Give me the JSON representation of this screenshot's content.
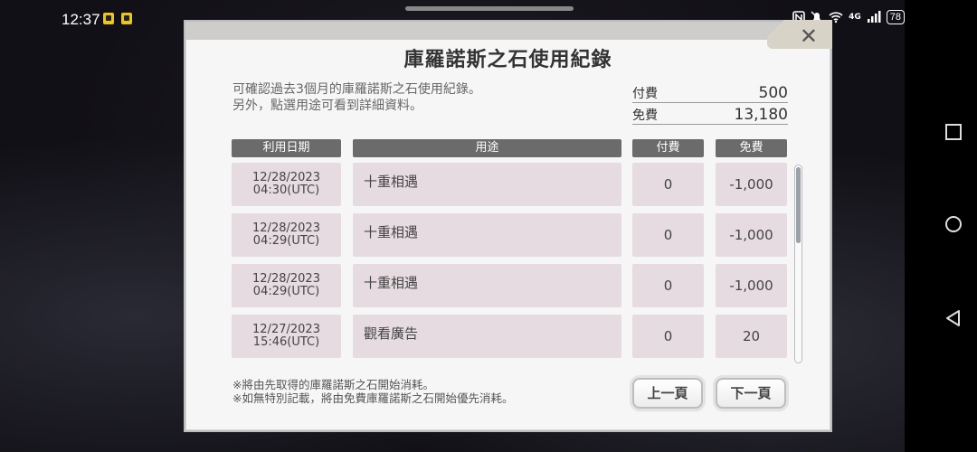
{
  "status_bar": {
    "time": "12:37",
    "signal": "4G",
    "battery": "78"
  },
  "dialog": {
    "title": "庫羅諾斯之石使用紀錄",
    "close_label": "✕",
    "description_line1": "可確認過去3個月的庫羅諾斯之石使用紀錄。",
    "description_line2": "另外，點選用途可看到詳細資料。",
    "summary": {
      "paid_label": "付費",
      "paid_value": "500",
      "free_label": "免費",
      "free_value": "13,180"
    },
    "columns": {
      "date": "利用日期",
      "use": "用途",
      "paid": "付費",
      "free": "免費"
    },
    "rows": [
      {
        "date": "12/28/2023",
        "time": "04:30(UTC)",
        "use": "十重相遇",
        "paid": "0",
        "free": "-1,000"
      },
      {
        "date": "12/28/2023",
        "time": "04:29(UTC)",
        "use": "十重相遇",
        "paid": "0",
        "free": "-1,000"
      },
      {
        "date": "12/28/2023",
        "time": "04:29(UTC)",
        "use": "十重相遇",
        "paid": "0",
        "free": "-1,000"
      },
      {
        "date": "12/27/2023",
        "time": "15:46(UTC)",
        "use": "觀看廣告",
        "paid": "0",
        "free": "20"
      }
    ],
    "notes": {
      "line1": "※將由先取得的庫羅諾斯之石開始消耗。",
      "line2": "※如無特別記載，將由免費庫羅諾斯之石開始優先消耗。"
    },
    "buttons": {
      "prev": "上一頁",
      "next": "下一頁"
    }
  }
}
